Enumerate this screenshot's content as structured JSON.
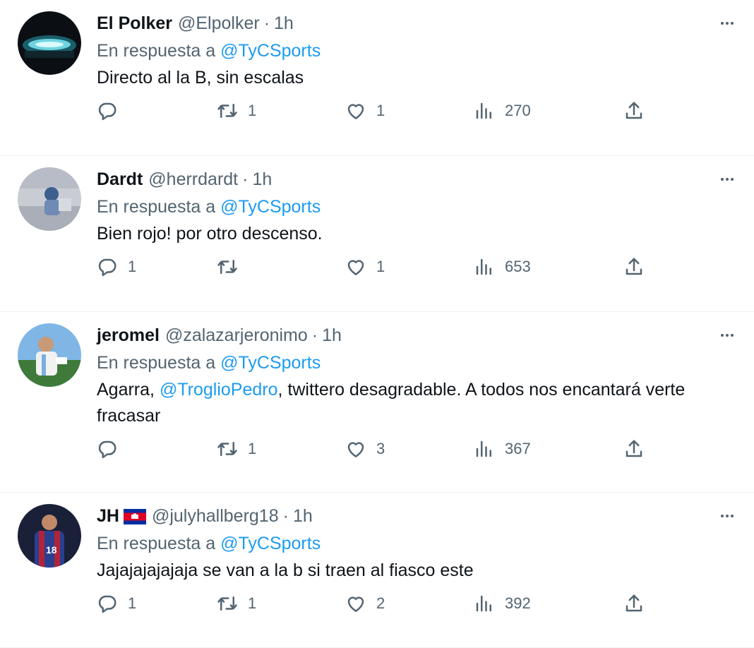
{
  "tweets": [
    {
      "name": "El Polker",
      "handle": "@Elpolker",
      "time": "1h",
      "reply_prefix": "En respuesta a",
      "reply_to": "@TyCSports",
      "text": "Directo al la B, sin escalas",
      "replies": "",
      "retweets": "1",
      "likes": "1",
      "views": "270"
    },
    {
      "name": "Dardt",
      "handle": "@herrdardt",
      "time": "1h",
      "reply_prefix": "En respuesta a",
      "reply_to": "@TyCSports",
      "text": "Bien rojo! por otro descenso.",
      "replies": "1",
      "retweets": "",
      "likes": "1",
      "views": "653"
    },
    {
      "name": "jeromel",
      "handle": "@zalazarjeronimo",
      "time": "1h",
      "reply_prefix": "En respuesta a",
      "reply_to": "@TyCSports",
      "text_before": "Agarra, ",
      "text_mention": "@TroglioPedro",
      "text_after": ", twittero desagradable. A todos nos encantará verte fracasar",
      "replies": "",
      "retweets": "1",
      "likes": "3",
      "views": "367"
    },
    {
      "name": "JH",
      "flag_icon": "cambodia-flag-icon",
      "handle": "@julyhallberg18",
      "time": "1h",
      "reply_prefix": "En respuesta a",
      "reply_to": "@TyCSports",
      "text": "Jajajajajajaja se van a la b si traen al fiasco este",
      "replies": "1",
      "retweets": "1",
      "likes": "2",
      "views": "392"
    }
  ],
  "ui": {
    "separator": "·",
    "icons": [
      "reply-icon",
      "retweet-icon",
      "like-icon",
      "views-icon",
      "share-icon",
      "more-icon"
    ],
    "colors": {
      "text": "#0f1419",
      "secondary": "#536471",
      "link": "#1d9bf0",
      "divider": "#eff3f4"
    }
  }
}
